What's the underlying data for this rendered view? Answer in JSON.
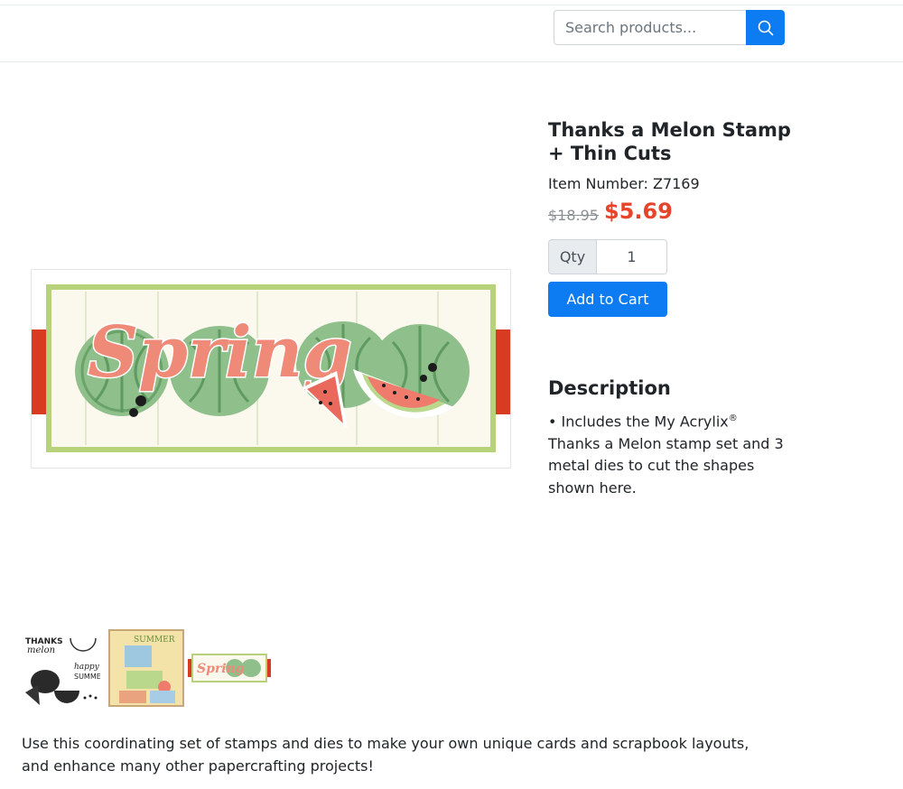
{
  "search": {
    "placeholder": "Search products..."
  },
  "product": {
    "title": "Thanks a Melon Stamp + Thin Cuts",
    "item_number_label": "Item Number: Z7169",
    "old_price": "$18.95",
    "new_price": "$5.69",
    "qty_label": "Qty",
    "qty_value": "1",
    "add_to_cart_label": "Add to Cart"
  },
  "main_image": {
    "word": "Spring"
  },
  "description": {
    "heading": "Description",
    "text_before": "• Includes the My Acrylix",
    "text_sup": "®",
    "text_after": " Thanks a Melon stamp set and 3 metal dies to cut the shapes shown here."
  },
  "thumbnails": {
    "thumb1_text_a": "THANKS",
    "thumb1_text_b": "melon",
    "thumb1_text_c": "happy",
    "thumb1_text_d": "SUMMER",
    "thumb2_text": "SUMMER",
    "thumb3_text": "Spring"
  },
  "footer": {
    "text": "Use this coordinating set of stamps and dies to make your own unique cards and scrapbook layouts, and enhance many other papercrafting projects!"
  },
  "colors": {
    "accent": "#0d7bf2",
    "sale": "#e8442b"
  }
}
